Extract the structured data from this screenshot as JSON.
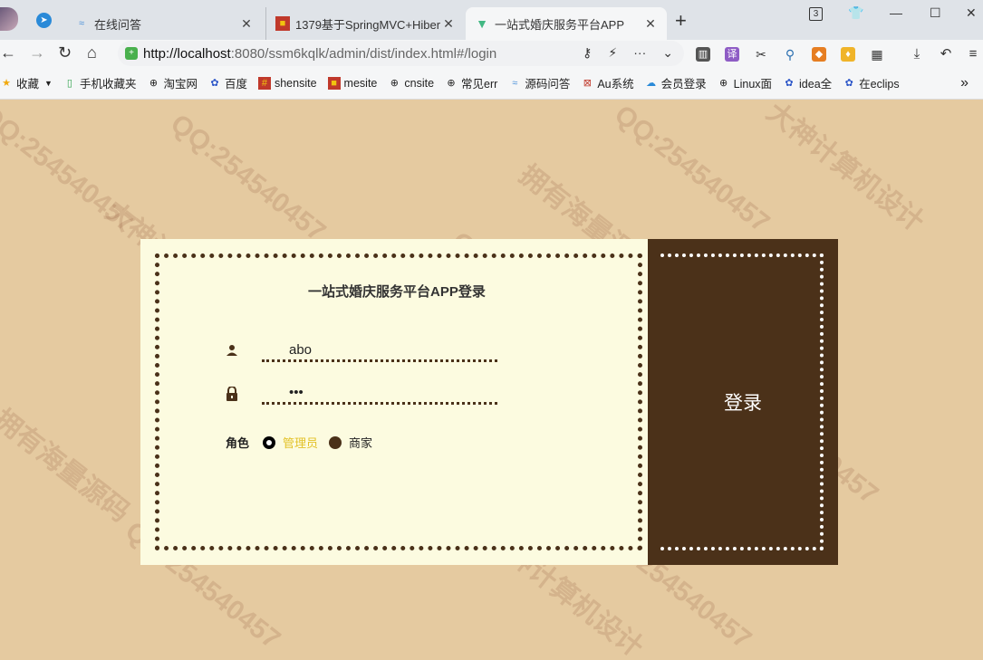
{
  "browser": {
    "tabs": [
      {
        "title": "在线问答",
        "icon": "wave-icon"
      },
      {
        "title": "1379基于SpringMVC+Hiber",
        "icon": "red-square-icon"
      },
      {
        "title": "一站式婚庆服务平台APP",
        "icon": "vue-icon"
      }
    ],
    "url_host": "http://localhost",
    "url_rest": ":8080/ssm6kqlk/admin/dist/index.html#/login",
    "tab_count": "3",
    "bookmarks": [
      "收藏",
      "手机收藏夹",
      "淘宝网",
      "百度",
      "shensite",
      "mesite",
      "cnsite",
      "常见err",
      "源码问答",
      "Au系统",
      "会员登录",
      "Linux面",
      "idea全",
      "在eclips"
    ]
  },
  "login": {
    "title": "一站式婚庆服务平台APP登录",
    "username_value": "abo",
    "password_value": "•••",
    "role_label": "角色",
    "roles": [
      "管理员",
      "商家"
    ],
    "selected_role": "管理员",
    "submit_label": "登录"
  },
  "watermark": [
    "QQ:254540457",
    "大神计算机设计",
    "拥有海量源码"
  ],
  "colors": {
    "page_bg": "#e5caa0",
    "card_bg": "#fcfbe0",
    "brand_brown": "#4b3119",
    "selected_role_text": "#e3c228"
  }
}
